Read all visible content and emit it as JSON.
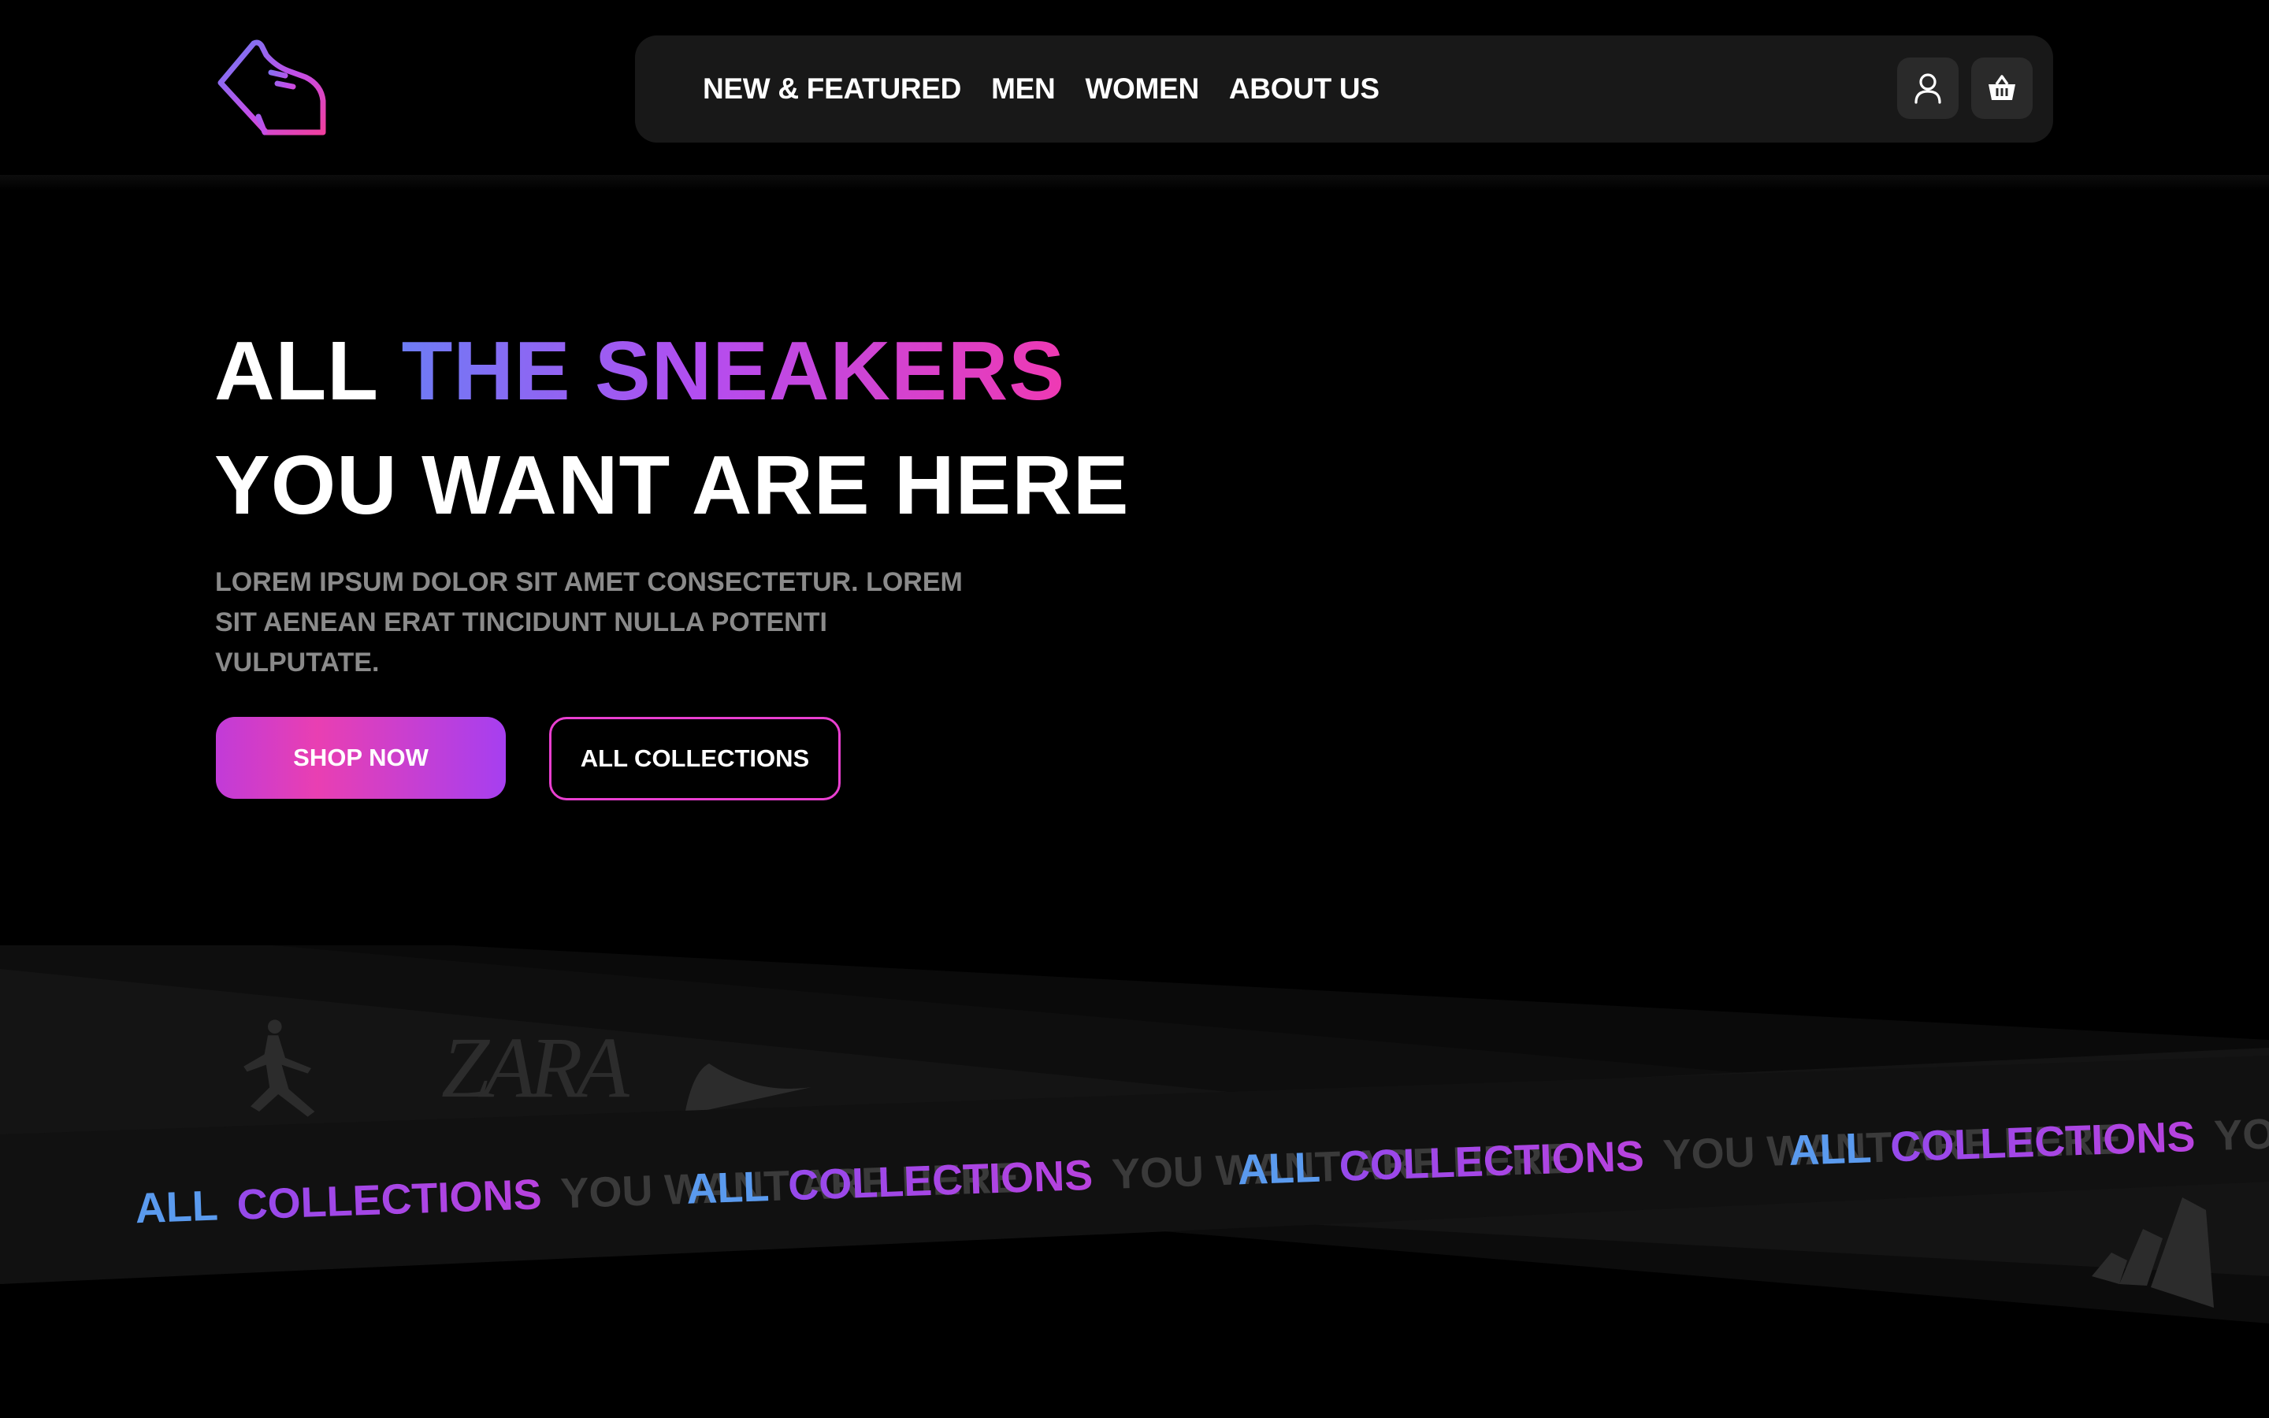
{
  "nav": {
    "links": [
      "NEW & FEATURED",
      "MEN",
      "WOMEN",
      "ABOUT US"
    ]
  },
  "hero": {
    "line1_plain": "ALL ",
    "line1_gradient": "THE SNEAKERS",
    "line2": "YOU WANT ARE HERE",
    "description": "LOREM IPSUM DOLOR SIT AMET CONSECTETUR. LOREM SIT AENEAN ERAT TINCIDUNT NULLA POTENTI VULPUTATE.",
    "shop_button": "SHOP NOW",
    "collections_button": "ALL COLLECTIONS"
  },
  "ribbon": {
    "word_all": "ALL",
    "word_collections": "COLLECTIONS",
    "tagline": "YOU WANT ARE HERE",
    "brand_zara": "ZARA"
  },
  "colors": {
    "background": "#000000",
    "navbar": "#181818",
    "gradient_start": "#6d7cf5",
    "gradient_mid": "#b34df0",
    "gradient_end": "#ef39b3",
    "muted_text": "#8a8a8a"
  },
  "icons": [
    "sneaker-logo-icon",
    "user-icon",
    "basket-icon",
    "jumpman-logo-icon",
    "swoosh-logo-icon",
    "three-stripes-logo-icon"
  ]
}
